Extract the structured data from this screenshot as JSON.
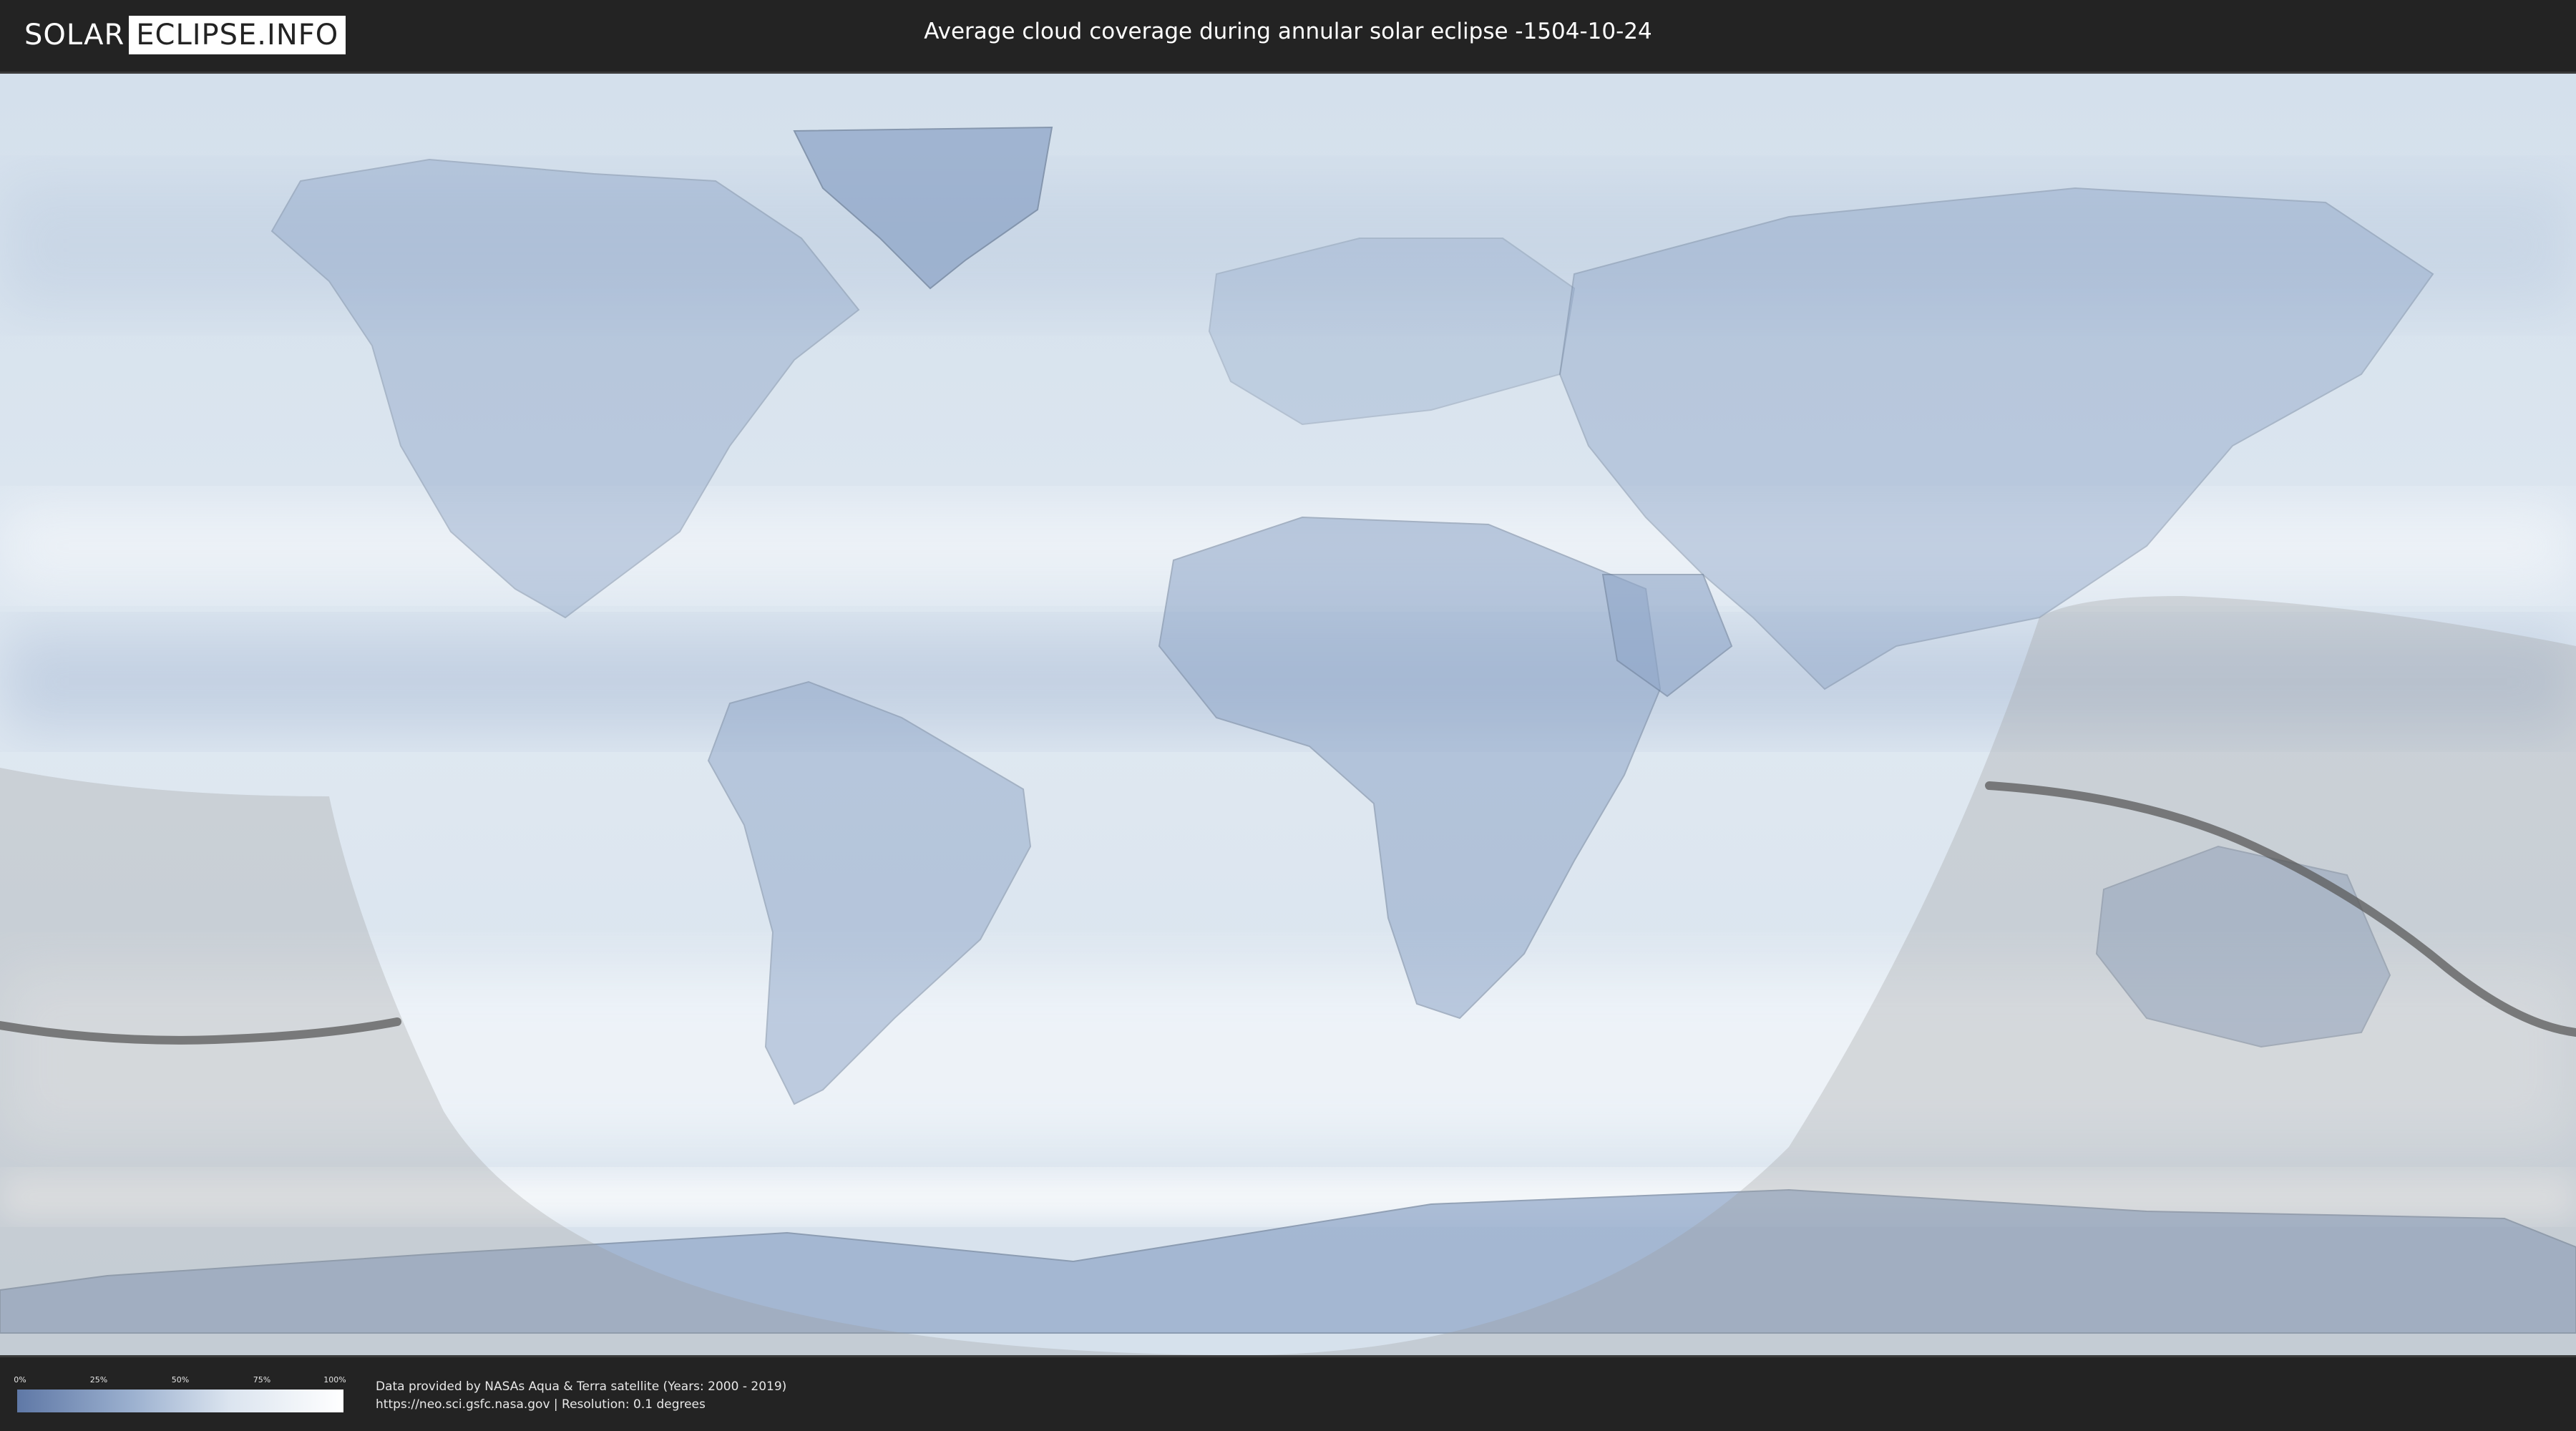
{
  "header": {
    "logo_left": "SOLAR",
    "logo_right": "ECLIPSE.INFO",
    "title": "Average cloud coverage during annular solar eclipse -1504-10-24"
  },
  "map": {
    "type": "cloud-coverage-world-map",
    "eclipse_type": "annular",
    "date": "-1504-10-24",
    "colors": {
      "clear": "#5f78a6",
      "cloudy": "#ffffff",
      "ocean_base": "#c9d8e8",
      "penumbra_shade": "#9a9a9a",
      "central_path": "#5a5a5a",
      "borders": "#6e7f96"
    }
  },
  "legend": {
    "ticks": [
      "0%",
      "25%",
      "50%",
      "75%",
      "100%"
    ],
    "gradient": [
      "#5f78a6",
      "#9bb0cf",
      "#dbe4ef",
      "#ffffff"
    ]
  },
  "footer": {
    "credit_line_1": "Data provided by NASAs Aqua & Terra satellite (Years: 2000 - 2019)",
    "credit_line_2": "https://neo.sci.gsfc.nasa.gov | Resolution: 0.1 degrees"
  }
}
